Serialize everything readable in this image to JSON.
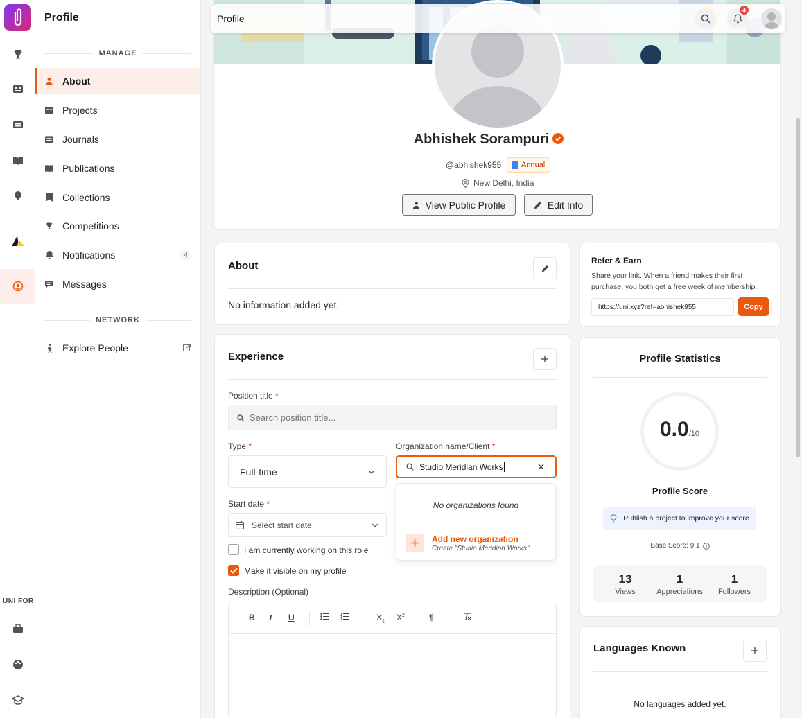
{
  "topbar": {
    "title": "Profile",
    "notification_count": "4"
  },
  "sidebar": {
    "title": "Profile",
    "section_manage": "MANAGE",
    "section_network": "NETWORK",
    "items": [
      {
        "label": "About"
      },
      {
        "label": "Projects"
      },
      {
        "label": "Journals"
      },
      {
        "label": "Publications"
      },
      {
        "label": "Collections"
      },
      {
        "label": "Competitions"
      },
      {
        "label": "Notifications",
        "badge": "4"
      },
      {
        "label": "Messages"
      }
    ],
    "network_items": [
      {
        "label": "Explore People"
      }
    ]
  },
  "rail": {
    "label": "UNI FOR"
  },
  "profile": {
    "name": "Abhishek Sorampuri",
    "handle": "@abhishek955",
    "plan": "Annual",
    "location": "New Delhi, India",
    "view_public_label": "View Public Profile",
    "edit_info_label": "Edit Info"
  },
  "about": {
    "title": "About",
    "empty_text": "No information added yet."
  },
  "experience": {
    "title": "Experience",
    "position_label": "Position title",
    "position_placeholder": "Search position title...",
    "type_label": "Type",
    "type_value": "Full-time",
    "org_label": "Organization name/Client",
    "org_value": "Studio Meridian Works",
    "org_no_results": "No organizations found",
    "org_add_label": "Add new organization",
    "org_add_sub": "Create \"Studio Meridian Works\"",
    "start_label": "Start date",
    "start_placeholder": "Select start date",
    "current_role_label": "I am currently working on this role",
    "current_role_checked": false,
    "visible_label": "Make it visible on my profile",
    "visible_checked": true,
    "description_label": "Description (Optional)"
  },
  "refer": {
    "title": "Refer & Earn",
    "text": "Share your link. When a friend makes their first purchase, you both get a free week of membership.",
    "link": "https://uni.xyz?ref=abhishek955",
    "copy_label": "Copy"
  },
  "stats": {
    "title": "Profile Statistics",
    "score": "0.0",
    "score_max": "/10",
    "score_label": "Profile Score",
    "tip": "Publish a project to improve your score",
    "base_score": "Base Score: 9.1",
    "views": "13",
    "views_label": "Views",
    "appreciations": "1",
    "appreciations_label": "Appreciations",
    "followers": "1",
    "followers_label": "Followers"
  },
  "languages": {
    "title": "Languages Known",
    "empty_text": "No languages added yet."
  },
  "colors": {
    "accent": "#ea580c",
    "accent_soft": "#fdeeea"
  }
}
